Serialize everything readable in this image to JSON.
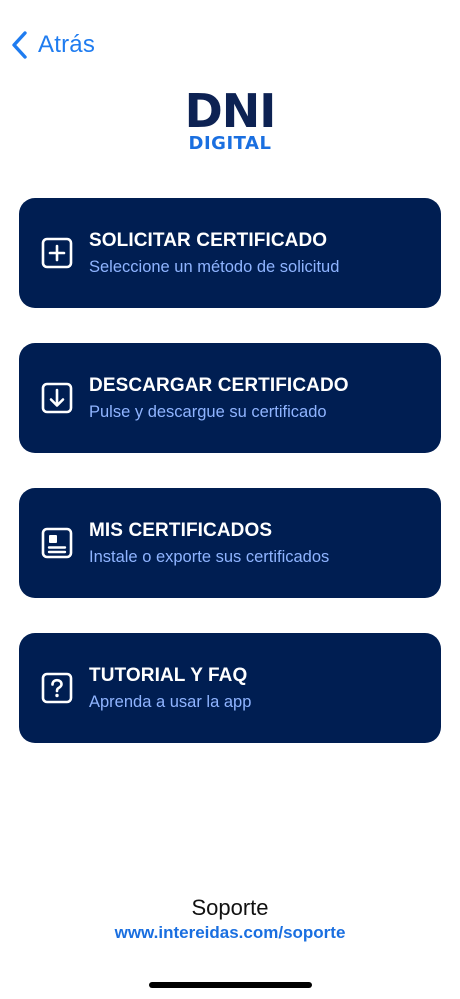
{
  "nav": {
    "back_label": "Atrás",
    "back_icon": "chevron-left-icon"
  },
  "logo": {
    "main": "DNI",
    "sub": "DIGITAL"
  },
  "menu": {
    "items": [
      {
        "icon": "plus-square-icon",
        "title": "SOLICITAR CERTIFICADO",
        "subtitle": "Seleccione un método de solicitud"
      },
      {
        "icon": "download-square-icon",
        "title": "DESCARGAR CERTIFICADO",
        "subtitle": "Pulse y descargue su certificado"
      },
      {
        "icon": "certificate-card-icon",
        "title": "MIS CERTIFICADOS",
        "subtitle": "Instale o exporte sus certificados"
      },
      {
        "icon": "question-square-icon",
        "title": "TUTORIAL Y FAQ",
        "subtitle": "Aprenda a usar la app"
      }
    ]
  },
  "support": {
    "title": "Soporte",
    "link": "www.intereidas.com/soporte"
  },
  "colors": {
    "accent": "#1f7cf0",
    "card_background": "#001e52",
    "card_subtitle": "#8fb4ff",
    "logo_dark": "#0d2253",
    "logo_blue": "#1a6fe0"
  }
}
